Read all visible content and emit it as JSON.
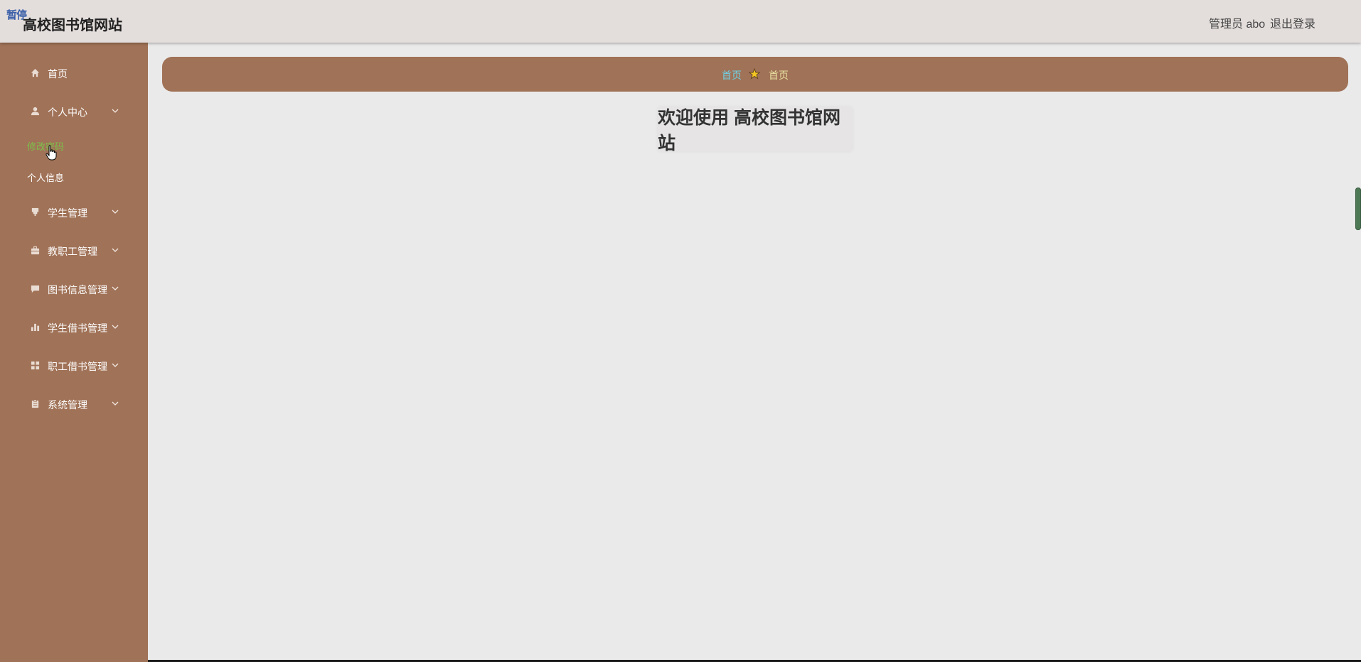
{
  "topbar": {
    "tag": "暂停",
    "title": "高校图书馆网站",
    "admin_label": "管理员 abo",
    "logout_label": "退出登录"
  },
  "sidebar": {
    "items": [
      {
        "label": "首页",
        "icon": "home-icon"
      },
      {
        "label": "个人中心",
        "icon": "user-icon"
      },
      {
        "label": "学生管理",
        "icon": "student-icon"
      },
      {
        "label": "教职工管理",
        "icon": "briefcase-icon"
      },
      {
        "label": "图书信息管理",
        "icon": "chat-icon"
      },
      {
        "label": "学生借书管理",
        "icon": "bar-chart-icon"
      },
      {
        "label": "职工借书管理",
        "icon": "grid-icon"
      },
      {
        "label": "系统管理",
        "icon": "clipboard-icon"
      }
    ],
    "sub_items": [
      {
        "label": "修改密码",
        "active": true
      },
      {
        "label": "个人信息",
        "active": false
      }
    ]
  },
  "breadcrumb": {
    "home": "首页",
    "current": "首页"
  },
  "main": {
    "welcome_text": "欢迎使用 高校图书馆网站"
  },
  "colors": {
    "sidebar": "#a07257",
    "topbar": "#e3dedc",
    "background": "#eaeaea",
    "active_sub": "#7cc04b",
    "breadcrumb_home": "#6fd1e6"
  }
}
